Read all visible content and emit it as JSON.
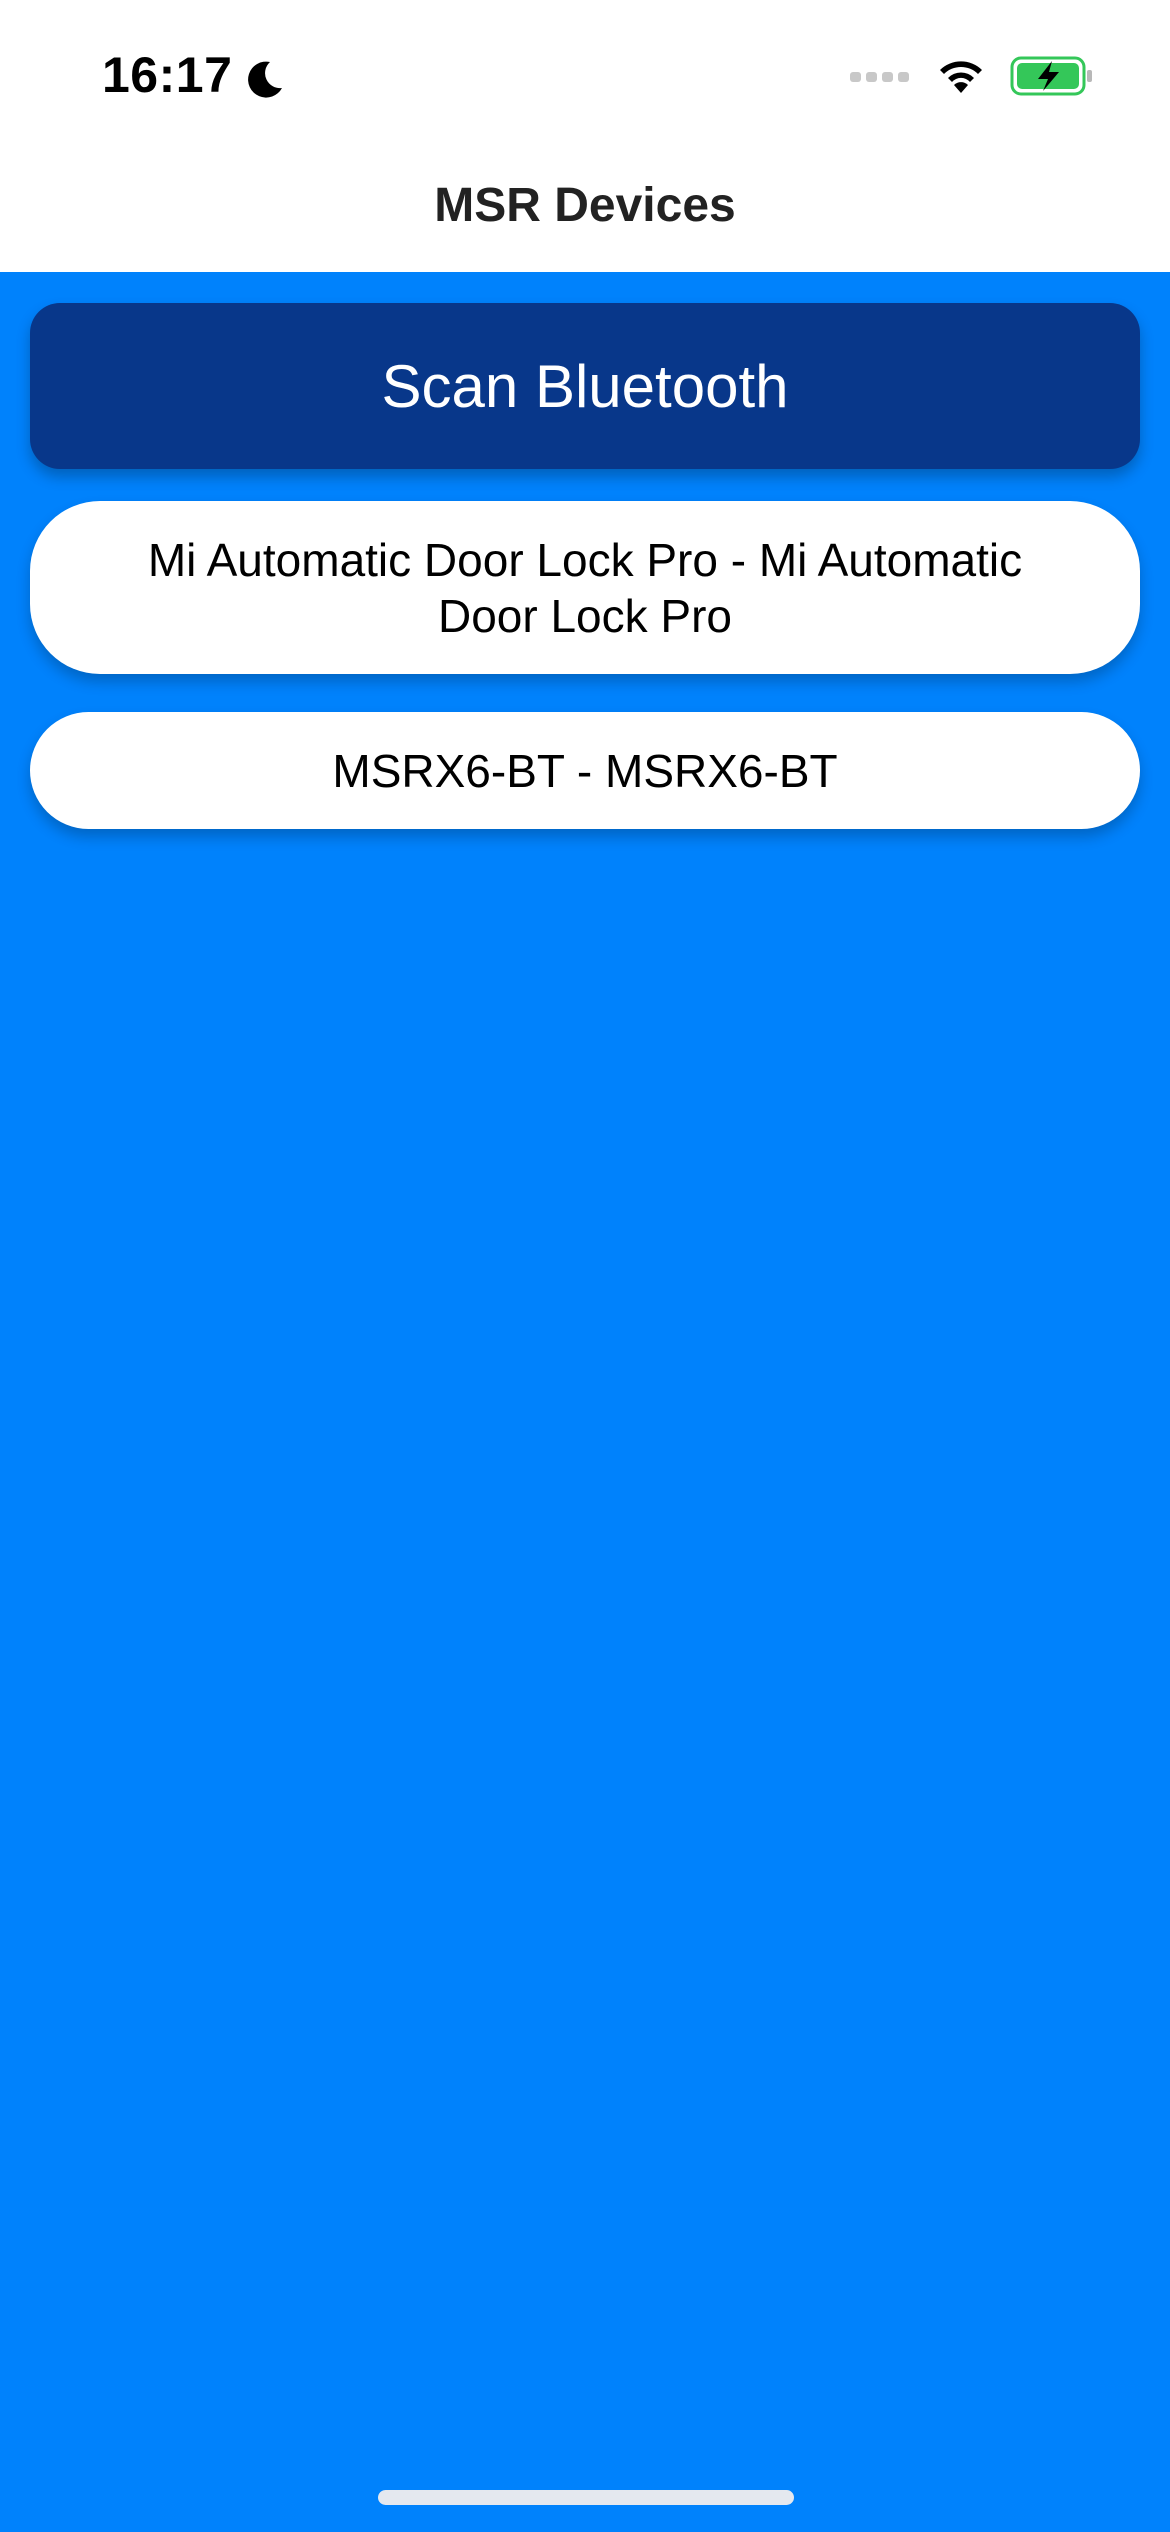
{
  "status_bar": {
    "time": "16:17",
    "icons": [
      "moon-icon",
      "cellular-signal-icon",
      "wifi-icon",
      "battery-charging-icon"
    ],
    "battery_color": "#34C759"
  },
  "nav": {
    "title": "MSR Devices"
  },
  "scan": {
    "label": "Scan Bluetooth"
  },
  "devices": [
    {
      "label": "Mi Automatic Door Lock Pro - Mi Automatic Door Lock Pro"
    },
    {
      "label": "MSRX6-BT - MSRX6-BT"
    }
  ],
  "colors": {
    "background": "#0082FC",
    "scan_button": "#08378A",
    "list_item": "#FFFFFF"
  }
}
